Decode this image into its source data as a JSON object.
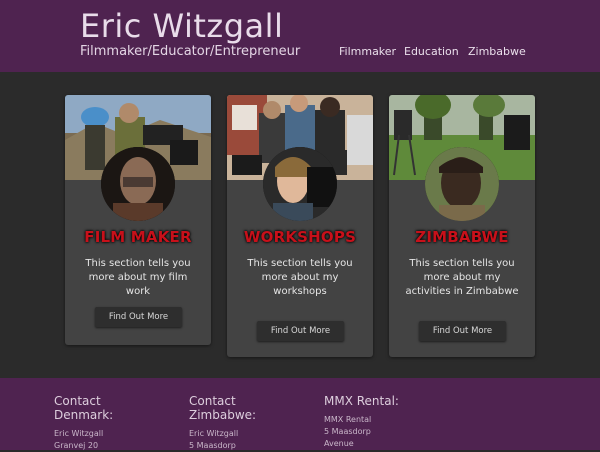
{
  "header": {
    "title": "Eric Witzgall",
    "tagline": "Filmmaker/Educator/Entrepreneur",
    "nav": [
      "Filmmaker",
      "Education",
      "Zimbabwe"
    ]
  },
  "cards": [
    {
      "title": "FILM MAKER",
      "text": "This section tells you more about my film work",
      "button": "Find Out More"
    },
    {
      "title": "WORKSHOPS",
      "text": "This section tells you more about my workshops",
      "button": "Find Out More"
    },
    {
      "title": "ZIMBABWE",
      "text": "This section tells you more about my activities in Zimbabwe",
      "button": "Find Out More"
    }
  ],
  "footer": {
    "columns": [
      {
        "heading": [
          "Contact",
          "Denmark:"
        ],
        "lines": [
          "Eric Witzgall",
          "Granvej 20"
        ]
      },
      {
        "heading": [
          "Contact",
          "Zimbabwe:"
        ],
        "lines": [
          "Eric Witzgall",
          "5 Maasdorp"
        ]
      },
      {
        "heading": [
          "MMX Rental:"
        ],
        "lines": [
          "MMX Rental",
          "5 Maasdorp",
          "Avenue"
        ]
      }
    ]
  },
  "colors": {
    "header_bg": "#4f2350",
    "card_bg": "#434343",
    "title_red": "#c8101a"
  }
}
